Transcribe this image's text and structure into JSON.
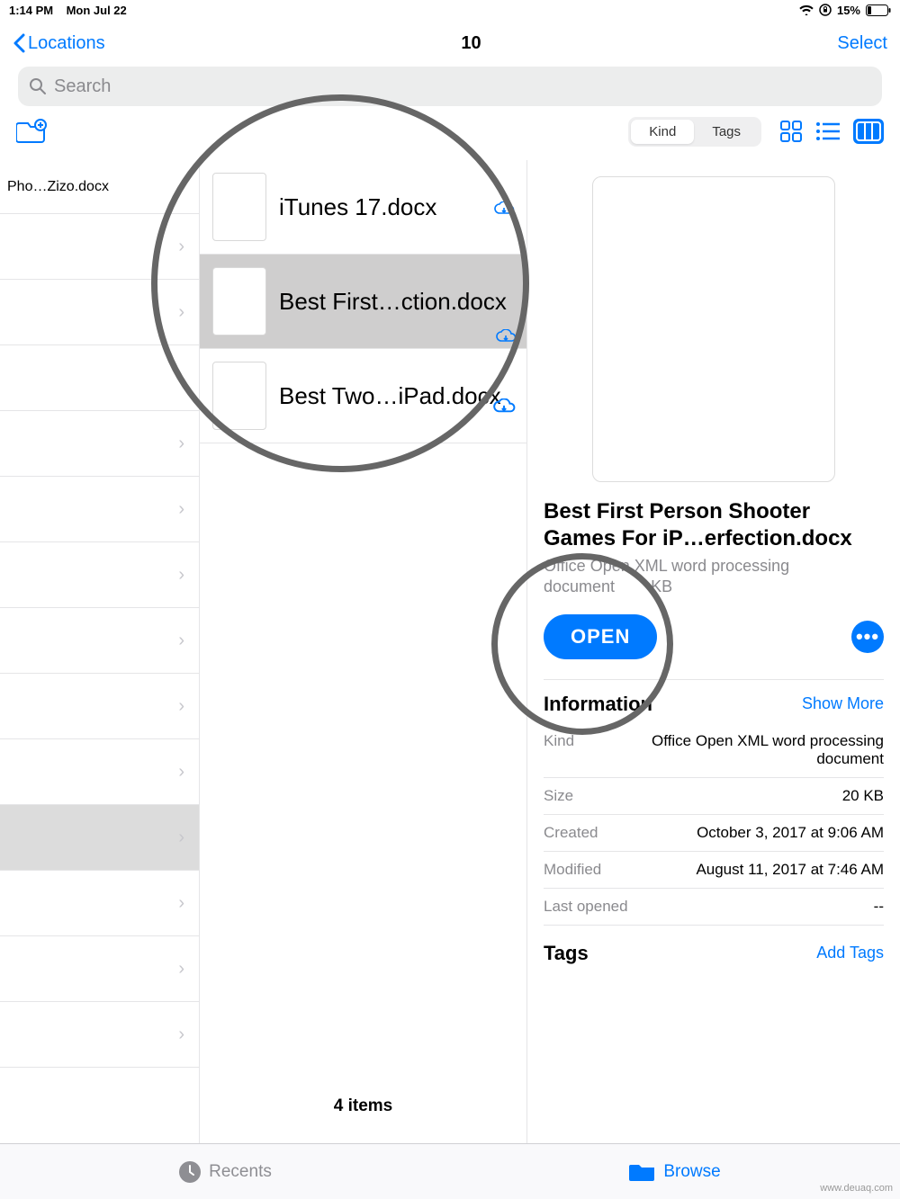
{
  "statusbar": {
    "time": "1:14 PM",
    "date": "Mon Jul 22",
    "battery": "15%"
  },
  "nav": {
    "back": "Locations",
    "title": "10",
    "select": "Select"
  },
  "search": {
    "placeholder": "Search"
  },
  "sorter": {
    "seg2": "Kind",
    "seg3": "Tags"
  },
  "column1": {
    "row1": "Pho…Zizo.docx"
  },
  "column2": {
    "files": [
      {
        "name": "iTunes 17.docx"
      },
      {
        "name": "Best First…ction.docx"
      },
      {
        "name": "Best Two…iPad.docx"
      }
    ],
    "count": "4 items"
  },
  "detail": {
    "filename": "Best First Person Shooter Games For iP…erfection.docx",
    "type_line1": "Office Open XML word processing",
    "type_line2": "document",
    "size_inline": "KB",
    "open": "OPEN",
    "info_header": "Information",
    "show_more": "Show More",
    "rows": {
      "kind_k": "Kind",
      "kind_v": "Office Open XML word processing document",
      "size_k": "Size",
      "size_v": "20 KB",
      "created_k": "Created",
      "created_v": "October 3, 2017 at 9:06 AM",
      "modified_k": "Modified",
      "modified_v": "August 11, 2017 at 7:46 AM",
      "lastopened_k": "Last opened",
      "lastopened_v": "--"
    },
    "tags_header": "Tags",
    "add_tags": "Add Tags"
  },
  "tabs": {
    "recents": "Recents",
    "browse": "Browse"
  },
  "watermark": "www.deuaq.com"
}
